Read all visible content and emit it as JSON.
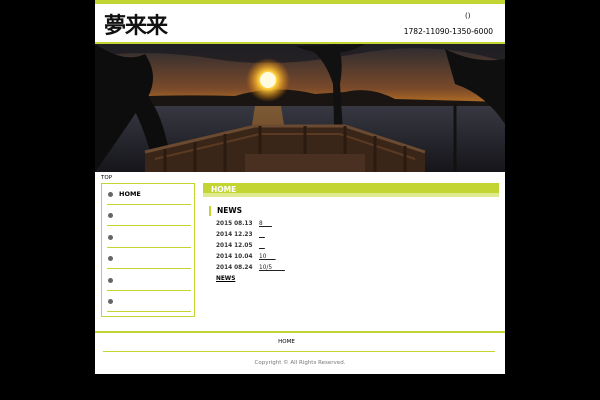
{
  "header": {
    "logo_text": "夢来来",
    "paren_text": "()",
    "phone": "1782-11090-1350-6000"
  },
  "hero": {
    "description_icon": "sunset-photo"
  },
  "breadcrumb": "TOP",
  "sidebar": {
    "items": [
      {
        "label": "HOME"
      },
      {
        "label": ""
      },
      {
        "label": ""
      },
      {
        "label": ""
      },
      {
        "label": ""
      },
      {
        "label": ""
      }
    ]
  },
  "main": {
    "section_title": "HOME",
    "news_heading": "NEWS",
    "news": [
      {
        "date": "2015 08.13",
        "text": "8     "
      },
      {
        "date": "2014 12.23",
        "text": "__"
      },
      {
        "date": "2014 12.05",
        "text": "__"
      },
      {
        "date": "2014 10.04",
        "text": "10     "
      },
      {
        "date": "2014 08.24",
        "text": "10/5       "
      }
    ],
    "news_more": "NEWS"
  },
  "footer": {
    "home_link": "HOME",
    "copyright": "Copyright ©  All Rights Reserved."
  },
  "colors": {
    "accent": "#c3d532",
    "accent_light": "#dfe98e",
    "background": "#000000"
  }
}
